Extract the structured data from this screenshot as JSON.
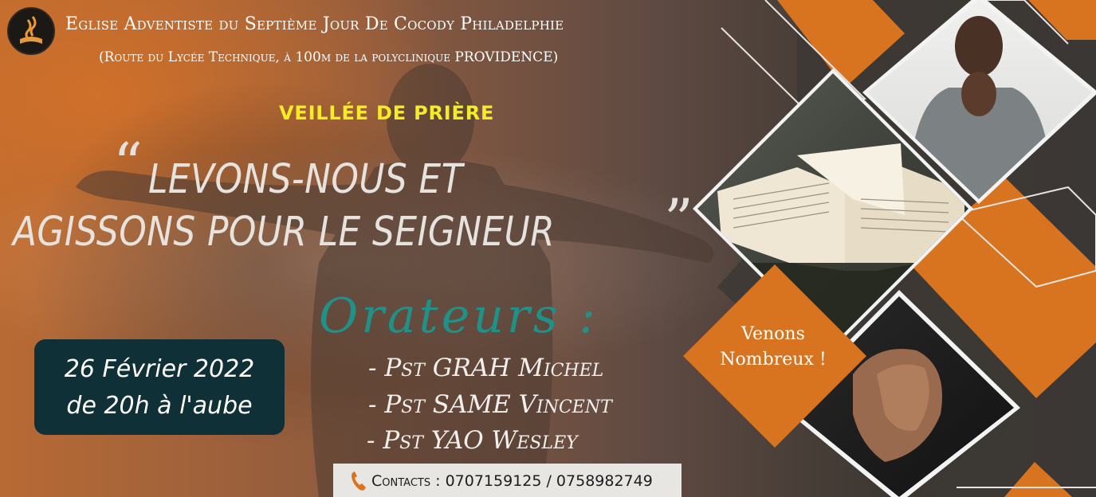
{
  "church": {
    "name": "Eglise Adventiste du Septième Jour De Cocody Philadelphie",
    "address": "(Route du Lycée Technique, à 100m de la polyclinique PROVIDENCE)"
  },
  "event": {
    "type": "VEILLÉE DE PRIÈRE",
    "theme_open_quote": "“",
    "theme_line1": "LEVONS-NOUS ET",
    "theme_line2": "AGISSONS POUR LE SEIGNEUR",
    "theme_close_quote": "”"
  },
  "schedule": {
    "date": "26 Février 2022",
    "time": "de 20h à l'aube"
  },
  "speakers": {
    "title": "Orateurs :",
    "list": [
      "- Pst GRAH Michel",
      "- Pst SAME Vincent",
      "- Pst YAO Wesley"
    ]
  },
  "contacts": {
    "text": "Contacts : 0707159125 / 0758982749",
    "icon": "phone-icon"
  },
  "call_to_action": {
    "line1": "Venons",
    "line2": "Nombreux !"
  },
  "colors": {
    "accent_orange": "#d8731f",
    "teal": "#1f9189",
    "yellow": "#f4ec25",
    "date_box": "#0f3036"
  }
}
